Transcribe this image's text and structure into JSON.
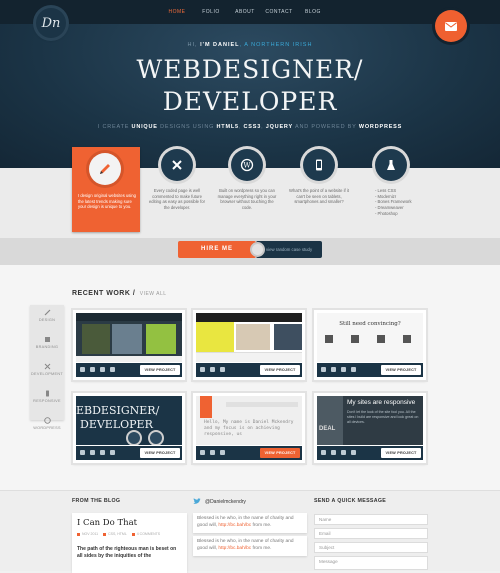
{
  "nav": {
    "items": [
      "HOME",
      "FOLIO",
      "ABOUT",
      "CONTACT",
      "BLOG"
    ],
    "logo_text": "Dn"
  },
  "hero": {
    "intro_pre": "HI, ",
    "intro_bold": "I'M DANIEL",
    "intro_post": ", A NORTHERN IRISH",
    "title_line1": "WEBDESIGNER/",
    "title_line2": "DEVELOPER",
    "tagline": {
      "p1": "I CREATE ",
      "b1": "UNIQUE",
      "p2": " DESIGNS USING ",
      "b2": "HTML5",
      "p3": ", ",
      "b3": "CSS3",
      "p4": ", ",
      "b4": "JQUERY",
      "p5": " AND POWERED BY ",
      "b5": "WORDPRESS"
    }
  },
  "services": [
    {
      "icon": "pencil-icon",
      "text": "I design original websites using the latest trends making sure your design is unique to you."
    },
    {
      "icon": "tools-icon",
      "text": "Every coded page is well commented to make future editing as easy as possible for the developer."
    },
    {
      "icon": "wordpress-icon",
      "text": "Built on wordpress so you can manage everything right in your browser without touching the code."
    },
    {
      "icon": "phone-icon",
      "text": "What's the point of a website if it can't be seen on tablets, smartphones and smaller?"
    },
    {
      "icon": "flask-icon",
      "text": "- Less CSS\n- Modernizr\n- Bones Framework\n- Dreamweaver\n- Photoshop"
    }
  ],
  "hire": {
    "button": "HIRE ME",
    "case_study": "view random case study"
  },
  "work": {
    "heading": "RECENT WORK",
    "view_all": "VIEW ALL",
    "filters": [
      "DESIGN",
      "BRANDING",
      "DEVELOPMENT",
      "RESPONSIVE",
      "WORDPRESS"
    ],
    "view_project": "VIEW PROJECT",
    "tile_texts": {
      "convincing": "Still need convincing?",
      "t4_line1": "EBDESIGNER/",
      "t4_line2": "DEVELOPER",
      "t5_hello": "Hello, My name is Daniel Mckendry and my focus is on achieving responsive, us",
      "t6_sites": "My sites are responsive",
      "t6_sub": "Don't let the look of the site fool you. All the sites I build are responsive and look great on all devices.",
      "t6_deal": "DEAL"
    }
  },
  "footer": {
    "blog_heading": "FROM THE BLOG",
    "blog_title": "I Can Do That",
    "blog_meta": [
      "NOV 2011",
      "CSS, HTML",
      "4 COMMENTS"
    ],
    "blog_excerpt": "The path of the righteous man is beset on all sides by the iniquities of the",
    "twitter_handle": "@Danielmckendry",
    "tweet_text": "Blessed is he who, in the name of charity and good will,",
    "tweet_link": "http://bc.bah/bc",
    "tweet_end": "from me.",
    "contact_heading": "SEND A QUICK MESSAGE",
    "fields": [
      "Name",
      "Email",
      "Subject",
      "Message"
    ]
  },
  "colors": {
    "accent": "#ef6232",
    "navy": "#1b3446",
    "link_blue": "#3aa9d8"
  }
}
